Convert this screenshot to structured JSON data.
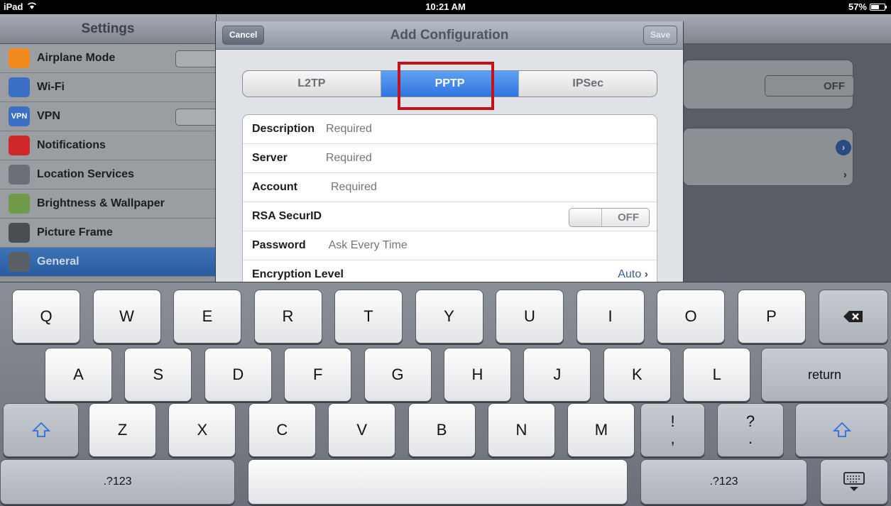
{
  "status_bar": {
    "device": "iPad",
    "time": "10:21 AM",
    "battery": "57%"
  },
  "settings": {
    "title": "Settings",
    "items": [
      {
        "label": "Airplane Mode",
        "icon": "airplane-icon",
        "color": "#f08a1e"
      },
      {
        "label": "Wi-Fi",
        "icon": "wifi-icon",
        "color": "#3b6fc4"
      },
      {
        "label": "VPN",
        "icon": "vpn-icon",
        "color": "#3b6fc4",
        "icon_text": "VPN"
      },
      {
        "label": "Notifications",
        "icon": "notifications-icon",
        "color": "#d0282a"
      },
      {
        "label": "Location Services",
        "icon": "location-icon",
        "color": "#6b6f76"
      },
      {
        "label": "Brightness & Wallpaper",
        "icon": "flower-icon",
        "color": "#6e9a4a"
      },
      {
        "label": "Picture Frame",
        "icon": "picture-frame-icon",
        "color": "#4a4d52"
      },
      {
        "label": "General",
        "icon": "gear-icon",
        "color": "#5c6066"
      }
    ],
    "active_item": "General"
  },
  "background_detail": {
    "toggle_state": "OFF"
  },
  "modal": {
    "title": "Add Configuration",
    "cancel_label": "Cancel",
    "save_label": "Save",
    "segments": [
      "L2TP",
      "PPTP",
      "IPSec"
    ],
    "selected_segment": "PPTP",
    "fields": {
      "description": {
        "label": "Description",
        "placeholder": "Required"
      },
      "server": {
        "label": "Server",
        "placeholder": "Required"
      },
      "account": {
        "label": "Account",
        "placeholder": "Required"
      },
      "rsa": {
        "label": "RSA SecurID",
        "state": "OFF"
      },
      "password": {
        "label": "Password",
        "placeholder": "Ask Every Time"
      },
      "encryption": {
        "label": "Encryption Level",
        "value": "Auto"
      }
    }
  },
  "keyboard": {
    "row1": [
      "Q",
      "W",
      "E",
      "R",
      "T",
      "Y",
      "U",
      "I",
      "O",
      "P"
    ],
    "row2": [
      "A",
      "S",
      "D",
      "F",
      "G",
      "H",
      "J",
      "K",
      "L"
    ],
    "row3": [
      "Z",
      "X",
      "C",
      "V",
      "B",
      "N",
      "M"
    ],
    "return_label": "return",
    "punct1": {
      "top": "!",
      "bottom": ","
    },
    "punct2": {
      "top": "?",
      "bottom": "."
    },
    "numbers_label": ".?123"
  },
  "colors": {
    "accent_blue": "#2f74e0",
    "highlight_red": "#c3121b"
  }
}
